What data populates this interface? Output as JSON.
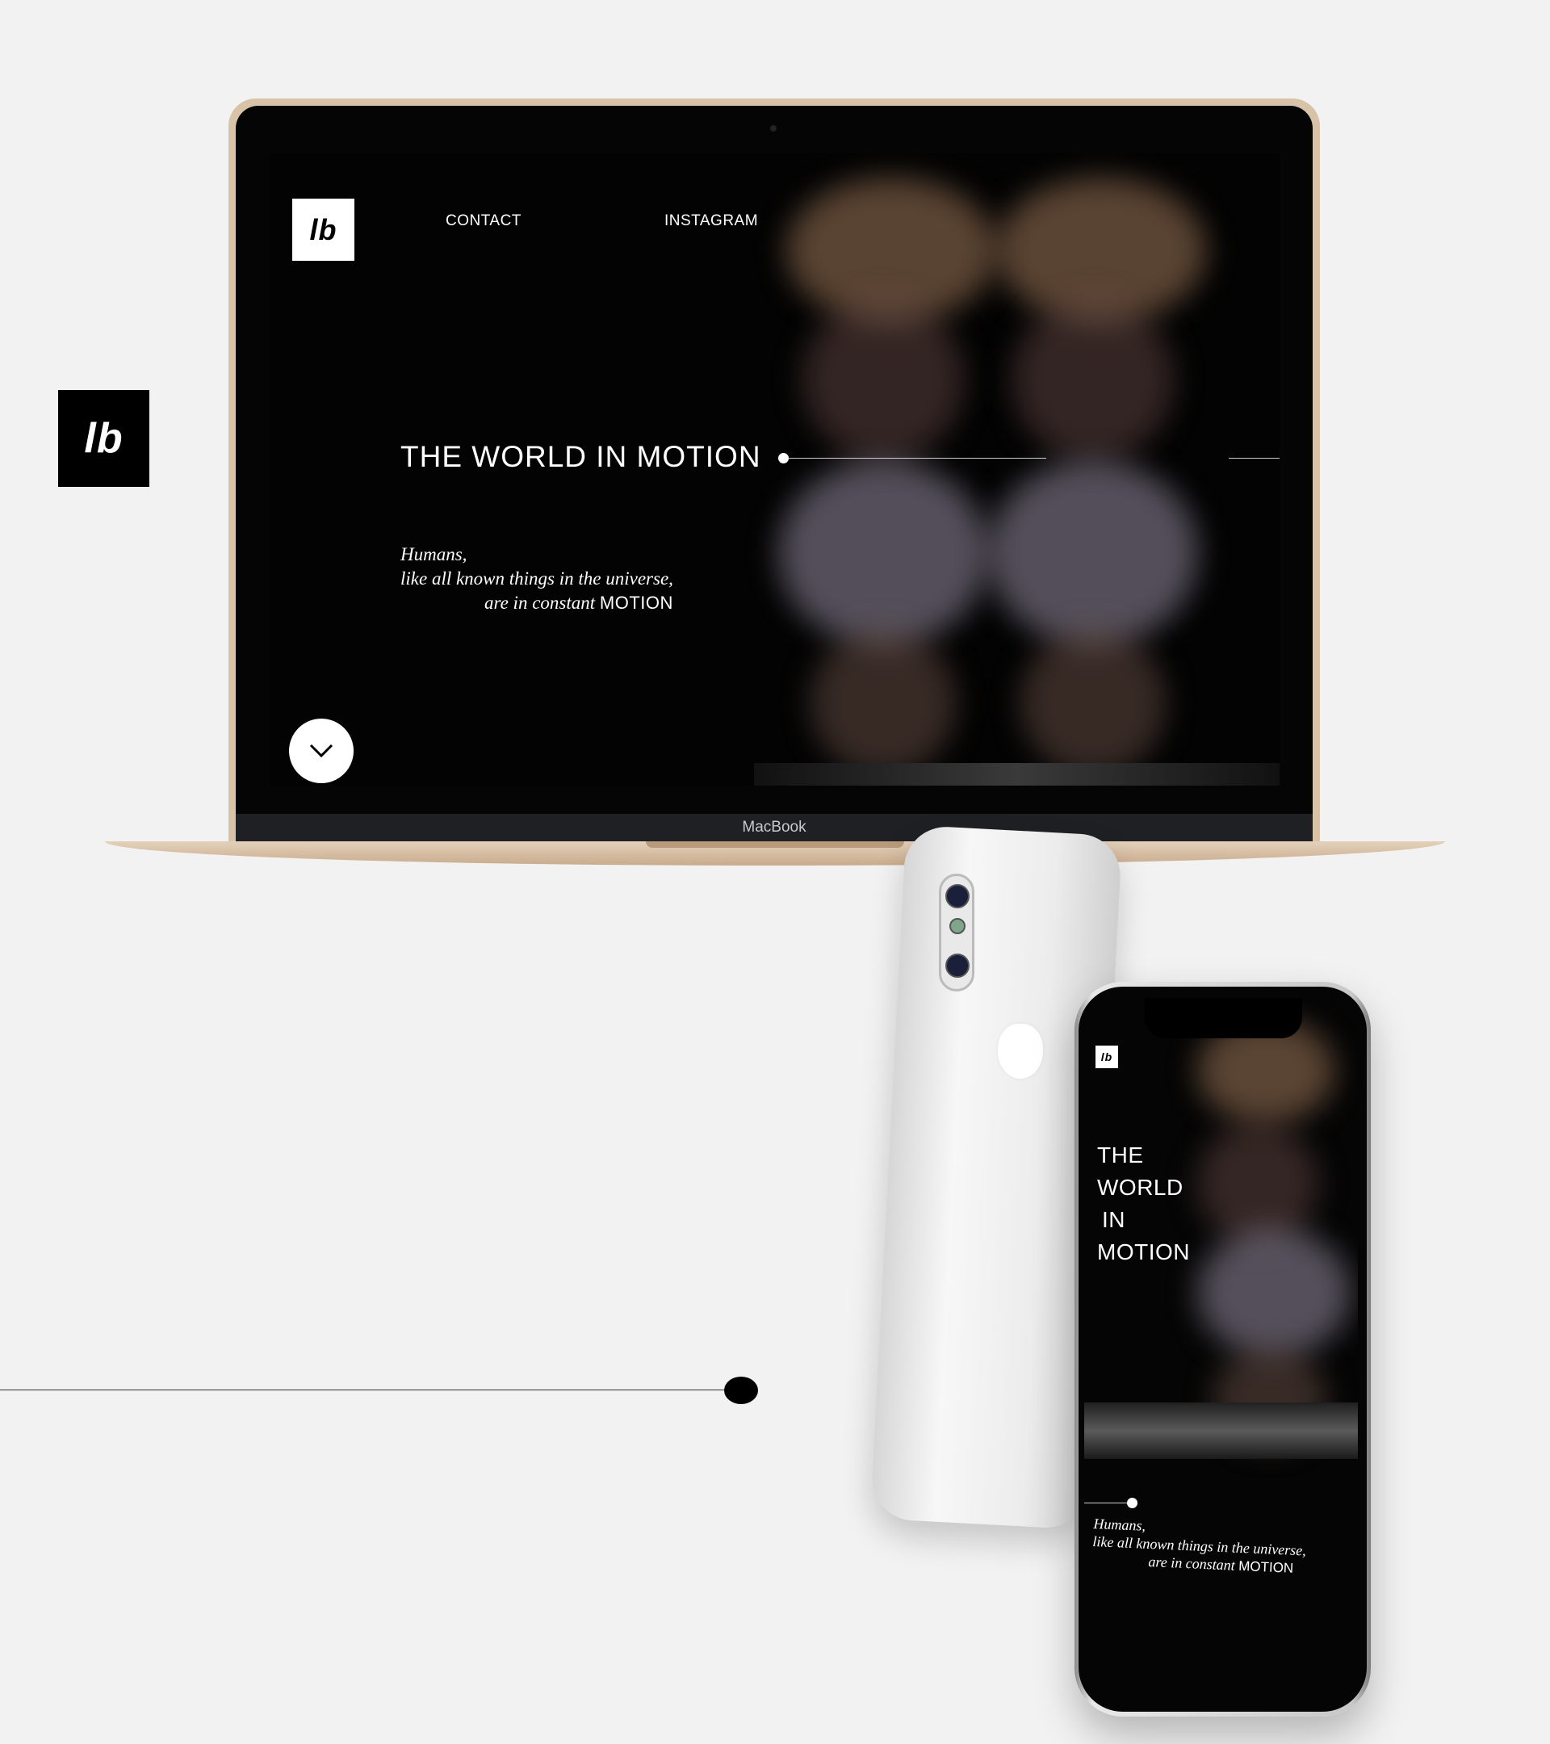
{
  "side_logo": {
    "text": "lb"
  },
  "macbook": {
    "label": "MacBook",
    "screen": {
      "logo_text": "lb",
      "nav": {
        "contact": "CONTACT",
        "instagram": "INSTAGRAM"
      },
      "hero_title": "THE WORLD IN MOTION",
      "quote": {
        "line1": "Humans,",
        "line2": "like all known things in the universe,",
        "line3_italic": "are in constant",
        "line3_caps": "MOTION"
      },
      "scroll_icon": "chevron-down-icon"
    }
  },
  "phone": {
    "logo_text": "lb",
    "title_lines": [
      "THE",
      "WORLD",
      "IN",
      "MOTION"
    ],
    "quote": {
      "line1": "Humans,",
      "line2": "like all known things in the universe,",
      "line3_italic": "are in constant",
      "line3_caps": "MOTION"
    }
  },
  "colors": {
    "background": "#f2f2f2",
    "screen": "#030303",
    "mac_gold": "#d8c2a8"
  }
}
